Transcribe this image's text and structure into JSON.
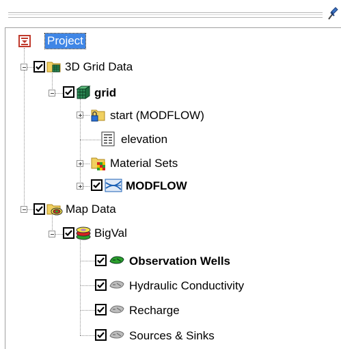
{
  "tree": {
    "project": {
      "label": "Project"
    },
    "grid_data": {
      "label": "3D Grid Data",
      "checked": true
    },
    "grid": {
      "label": "grid",
      "checked": true
    },
    "start": {
      "label": "start (MODFLOW)"
    },
    "elevation": {
      "label": "elevation"
    },
    "material_sets": {
      "label": "Material Sets"
    },
    "modflow": {
      "label": "MODFLOW",
      "checked": true
    },
    "map_data": {
      "label": "Map Data",
      "checked": true
    },
    "bigval": {
      "label": "BigVal",
      "checked": true
    },
    "observation_wells": {
      "label": "Observation Wells",
      "checked": true
    },
    "hydraulic_conductivity": {
      "label": "Hydraulic Conductivity",
      "checked": true
    },
    "recharge": {
      "label": "Recharge",
      "checked": true
    },
    "sources_sinks": {
      "label": "Sources & Sinks",
      "checked": true
    }
  },
  "icons": {
    "pin": "pin-icon",
    "project": "project-icon",
    "grid_data": "folder-grid-icon",
    "grid": "grid-cube-icon",
    "start": "locked-folder-icon",
    "elevation": "dataset-icon",
    "material_sets": "material-sets-icon",
    "modflow": "modflow-icon",
    "map_data": "map-folder-icon",
    "bigval": "coverage-icon",
    "active_layer": "active-layer-icon",
    "inactive_layer": "inactive-layer-icon"
  },
  "colors": {
    "selection": "#3f86e6",
    "project_icon": "#c0392b",
    "grid_green": "#2e8b57",
    "folder": "#e8c64a",
    "modflow_blue": "#1a5fb4"
  }
}
